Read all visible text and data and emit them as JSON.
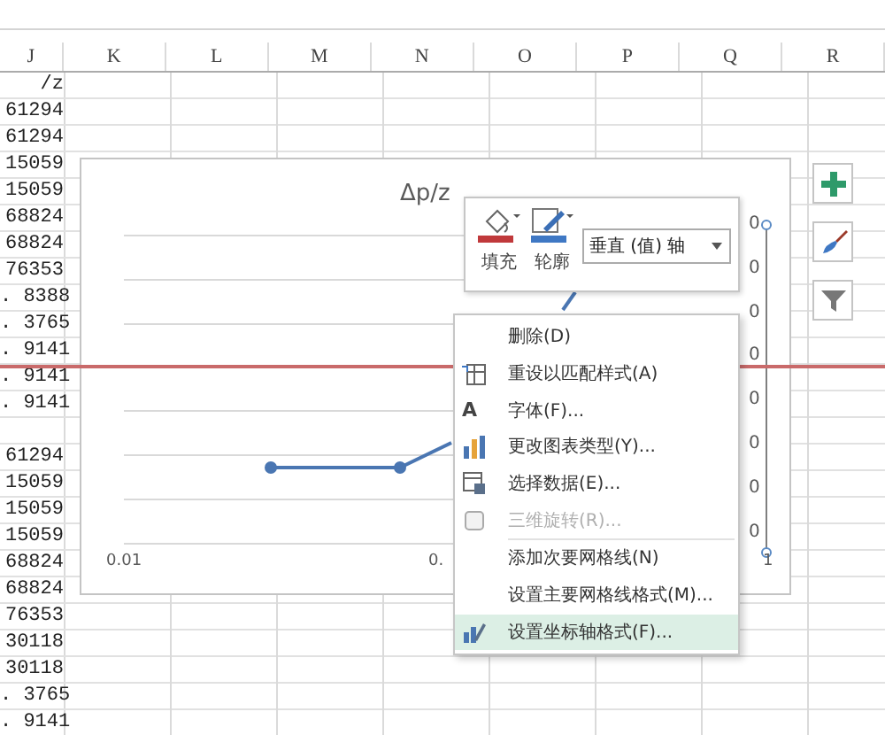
{
  "column_headers": [
    "J",
    "K",
    "L",
    "M",
    "N",
    "O",
    "P",
    "Q",
    "R"
  ],
  "column_j_upper": [
    "/z",
    "61294",
    "61294",
    "15059",
    "15059",
    "68824",
    "68824",
    "76353",
    ". 8388",
    ". 3765",
    ". 9141",
    ". 9141",
    ". 9141"
  ],
  "column_j_lower": [
    "61294",
    "15059",
    "15059",
    "15059",
    "68824",
    "68824",
    "76353",
    "30118",
    "30118",
    ". 3765",
    ". 9141"
  ],
  "chart": {
    "title": "Δp/z",
    "x_axis_labels": [
      "0.01",
      "0.",
      "1"
    ],
    "right_axis_labels": [
      "0",
      "0",
      "0",
      "0",
      "0",
      "0",
      "0",
      "0"
    ]
  },
  "mini_toolbar": {
    "fill_label": "填充",
    "outline_label": "轮廓",
    "element_dropdown": "垂直 (值) 轴"
  },
  "context_menu": [
    {
      "label": "删除(D)",
      "kind": "plain",
      "disabled": false,
      "selected": false
    },
    {
      "label": "重设以匹配样式(A)",
      "kind": "reset",
      "disabled": false,
      "selected": false
    },
    {
      "label": "字体(F)...",
      "kind": "font",
      "icon_text": "A",
      "disabled": false,
      "selected": false
    },
    {
      "label": "更改图表类型(Y)...",
      "kind": "chart",
      "disabled": false,
      "selected": false
    },
    {
      "label": "选择数据(E)...",
      "kind": "data",
      "disabled": false,
      "selected": false
    },
    {
      "label": "三维旋转(R)...",
      "kind": "rotate",
      "disabled": true,
      "selected": false,
      "separator_after": true
    },
    {
      "label": "添加次要网格线(N)",
      "kind": "plain",
      "disabled": false,
      "selected": false
    },
    {
      "label": "设置主要网格线格式(M)...",
      "kind": "plain",
      "disabled": false,
      "selected": false
    },
    {
      "label": "设置坐标轴格式(F)...",
      "kind": "axis",
      "disabled": false,
      "selected": true
    }
  ],
  "side_buttons": [
    {
      "kind": "add"
    },
    {
      "kind": "style"
    },
    {
      "kind": "filter"
    }
  ]
}
